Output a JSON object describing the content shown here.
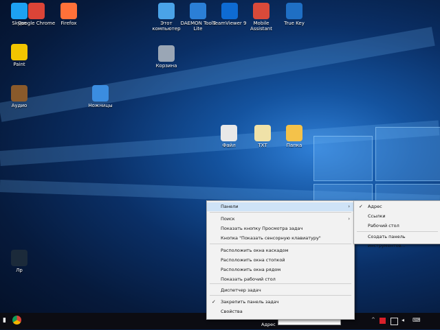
{
  "desktop_icons": [
    {
      "label": "Skype",
      "icon": "skype-icon",
      "color": "#1da1f2"
    },
    {
      "label": "Google Chrome",
      "icon": "chrome-icon",
      "color": "#db4437"
    },
    {
      "label": "Firefox",
      "icon": "firefox-icon",
      "color": "#ff7139"
    },
    {
      "label": "Этот компьютер",
      "icon": "computer-icon",
      "color": "#4aa3e8"
    },
    {
      "label": "DAEMON Tools Lite",
      "icon": "daemon-tools-icon",
      "color": "#2b7fd6"
    },
    {
      "label": "TeamViewer 9",
      "icon": "teamviewer-icon",
      "color": "#0e6bd3"
    },
    {
      "label": "Mobile Assistant",
      "icon": "mobile-assistant-icon",
      "color": "#d94a3a"
    },
    {
      "label": "True Key",
      "icon": "true-key-icon",
      "color": "#1f6fc4"
    },
    {
      "label": "Paint",
      "icon": "paint-icon",
      "color": "#f2c500"
    },
    {
      "label": "Корзина",
      "icon": "recycle-bin-icon",
      "color": "#9aa6b5"
    },
    {
      "label": "Ножницы",
      "icon": "snipping-tool-icon",
      "color": "#3b8de0"
    },
    {
      "label": "Аудио",
      "icon": "audio-icon",
      "color": "#8a5a2b"
    },
    {
      "label": "Лр",
      "icon": "lightroom-icon",
      "color": "#1b2a3a"
    },
    {
      "label": "Файл",
      "icon": "file-icon",
      "color": "#e8e8e8"
    },
    {
      "label": "TXT",
      "icon": "txt-file-icon",
      "color": "#f0e2a8"
    },
    {
      "label": "Папка",
      "icon": "folder-icon",
      "color": "#f4c24a"
    }
  ],
  "context_menu": {
    "items": [
      {
        "label": "Панели",
        "has_submenu": true,
        "checked": false,
        "highlighted": true
      },
      {
        "label": "Поиск",
        "has_submenu": true,
        "checked": false,
        "highlighted": false
      },
      {
        "label": "Показать кнопку Просмотра задач",
        "has_submenu": false,
        "checked": false,
        "highlighted": false
      },
      {
        "label": "Кнопка \"Показать сенсорную клавиатуру\"",
        "has_submenu": false,
        "checked": false,
        "highlighted": false
      },
      {
        "label": "Расположить окна каскадом",
        "has_submenu": false,
        "checked": false,
        "highlighted": false
      },
      {
        "label": "Расположить окна стопкой",
        "has_submenu": false,
        "checked": false,
        "highlighted": false
      },
      {
        "label": "Расположить окна рядом",
        "has_submenu": false,
        "checked": false,
        "highlighted": false
      },
      {
        "label": "Показать рабочий стол",
        "has_submenu": false,
        "checked": false,
        "highlighted": false
      },
      {
        "label": "Диспетчер задач",
        "has_submenu": false,
        "checked": false,
        "highlighted": false
      },
      {
        "label": "Закрепить панель задач",
        "has_submenu": false,
        "checked": true,
        "highlighted": false
      },
      {
        "label": "Свойства",
        "has_submenu": false,
        "checked": false,
        "highlighted": false
      }
    ]
  },
  "submenu": {
    "items": [
      {
        "label": "Адрес",
        "checked": true
      },
      {
        "label": "Ссылки",
        "checked": false
      },
      {
        "label": "Рабочий стол",
        "checked": false
      },
      {
        "label": "Создать панель инструментов...",
        "checked": false
      }
    ]
  },
  "taskbar": {
    "address_label": "Адрес",
    "address_value": "",
    "time": "",
    "tray_icons": [
      "chevron-up-icon",
      "adobe-icon",
      "network-icon",
      "volume-icon",
      "keyboard-icon"
    ]
  },
  "colors": {
    "accent": "#0078d7",
    "menu_bg": "#f2f2f2",
    "menu_highlight": "#cfe3f7"
  }
}
